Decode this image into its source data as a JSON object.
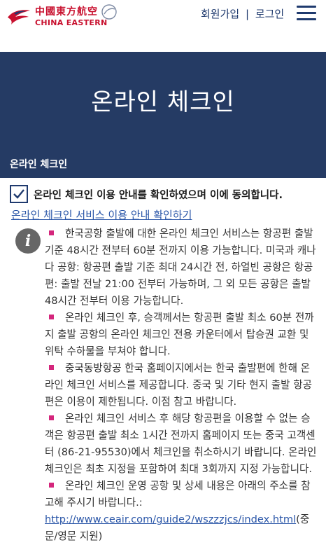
{
  "header": {
    "logo_cn": "中國東方航空",
    "logo_en": "CHINA EASTERN",
    "signup": "회원가입",
    "separator": "|",
    "login": "로그인",
    "menu_icon": "hamburger-menu-icon",
    "brand_color": "#c8102e",
    "nav_color": "#1f3a6e"
  },
  "hero": {
    "title": "온라인 체크인",
    "subtitle": "온라인 체크인",
    "background": "#253b64"
  },
  "agreement": {
    "checked": true,
    "text": "온라인 체크인 이용 안내를 확인하였으며 이에 동의합니다.",
    "link": "온라인 체크인 서비스 이용 안내 확인하기"
  },
  "notices": {
    "icon": "info-icon",
    "bullet_color": "#d4267c",
    "items": [
      "한국공항 출발에 대한 온라인 체크인 서비스는 항공편 출발 기준 48시간 전부터 60분 전까지 이용 가능합니다. 미국과 캐나다 공항: 항공편 출발 기준 최대 24시간 전, 하얼빈 공항은 항공편: 출발 전날 21:00 전부터 가능하며, 그 외 모든 공항은 출발 48시간 전부터 이용 가능합니다.",
      "온라인 체크인 후, 승객께서는 항공편 출발 최소 60분 전까지 출발 공항의 온라인 체크인 전용 카운터에서 탑승권 교환 및 위탁 수하물을 부쳐야 합니다.",
      "중국동방항공 한국 홈페이지에서는 한국 출발편에 한해 온라인 체크인 서비스를 제공합니다. 중국 및 기타 현지 출발 항공편은 이용이 제한됩니다. 이점 참고 바랍니다.",
      "온라인 체크인 서비스 후 해당 항공편을 이용할 수 없는 승객은 항공편 출발 최소 1시간 전까지 홈페이지 또는 중국 고객센터 (86-21-95530)에서 체크인을 취소하시기 바랍니다. 온라인 체크인은 최초 지정을 포함하여 최대 3회까지 지정 가능합니다.",
      "온라인 체크인 운영 공항 및 상세 내용은 아래의 주소를 참고해 주시기 바랍니다.:"
    ],
    "url": "http://www.ceair.com/guide2/wszzzjcs/index.html",
    "url_suffix": "(중문/영문 지원)"
  }
}
